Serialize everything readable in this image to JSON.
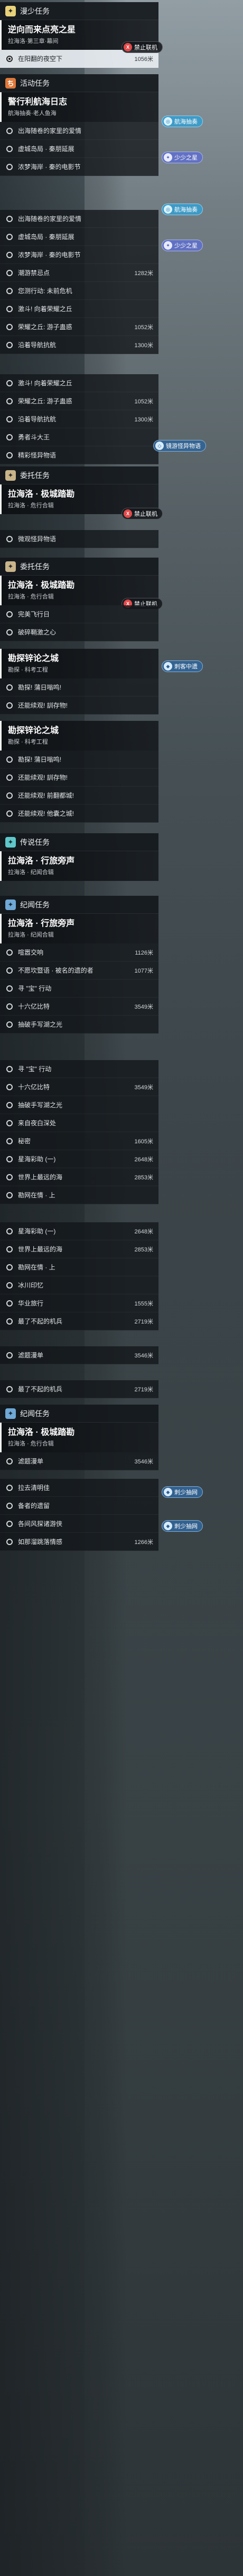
{
  "sections": {
    "main": {
      "icon": "✦",
      "title": "漫少任务"
    },
    "event": {
      "icon": "ち",
      "title": "活动任务"
    },
    "commission1": {
      "icon": "✦",
      "title": "委托任务"
    },
    "commission2": {
      "icon": "✦",
      "title": "委托任务"
    },
    "legend": {
      "icon": "✦",
      "title": "传说任务"
    },
    "world1": {
      "icon": "✦",
      "title": "纪闻任务"
    },
    "world2": {
      "icon": "✦",
      "title": "纪闻任务"
    }
  },
  "cards": {
    "c1": {
      "title": "逆向而来点亮之星",
      "sub": "拉海洛·第三章·幕间"
    },
    "c2": {
      "title": "警行利航海日志",
      "sub": "航海抽奏·老人鱼海"
    },
    "c3": {
      "title": "拉海洛 · 极城踏勘",
      "sub": "拉海洛 · 危行合辑"
    },
    "c4": {
      "title": "拉海洛 · 极城踏勘",
      "sub": "拉海洛 · 危行合辑"
    },
    "c5": {
      "title": "勘探锌论之城",
      "sub": "勘探 · 科考工程"
    },
    "c6": {
      "title": "勘探锌论之城",
      "sub": "勘探 · 科考工程"
    },
    "c7": {
      "title": "拉海洛 · 行旅旁声",
      "sub": "拉海洛 · 纪闻合辑"
    },
    "c8": {
      "title": "拉海洛 · 行旅旁声",
      "sub": "拉海洛 · 纪闻合辑"
    },
    "c9": {
      "title": "拉海洛 · 极城踏勘",
      "sub": "拉海洛 · 危行合辑"
    }
  },
  "rows": [
    {
      "label": "在阳翻的夜空下",
      "dist": "1056米",
      "active": true
    },
    {
      "label": "出海随卷的家里的爱情",
      "dist": ""
    },
    {
      "label": "虚城岛局 · 秦朋延展",
      "dist": ""
    },
    {
      "label": "浓梦海岸 · 秦的电影节",
      "dist": ""
    },
    {
      "label": "出海随卷的家里的爱情",
      "dist": ""
    },
    {
      "label": "虚城岛局 · 秦朋延展",
      "dist": ""
    },
    {
      "label": "浓梦海岸 · 秦的电影节",
      "dist": ""
    },
    {
      "label": "潮游禁忌点",
      "dist": "1282米"
    },
    {
      "label": "您测行动: 未前危机",
      "dist": ""
    },
    {
      "label": "激斗! 向着荣耀之丘",
      "dist": ""
    },
    {
      "label": "荣耀之丘: 游子蛊惑",
      "dist": "1052米"
    },
    {
      "label": "沿着导航抗航",
      "dist": "1300米"
    },
    {
      "label": "激斗! 向着荣耀之丘",
      "dist": ""
    },
    {
      "label": "荣耀之丘: 游子蛊惑",
      "dist": "1052米"
    },
    {
      "label": "沿着导航抗航",
      "dist": "1300米"
    },
    {
      "label": "勇者斗大王",
      "dist": ""
    },
    {
      "label": "精彩怪异物语",
      "dist": ""
    },
    {
      "label": "微观怪异物语",
      "dist": ""
    },
    {
      "label": "完美飞行日",
      "dist": ""
    },
    {
      "label": "破碎鞘激之心",
      "dist": ""
    },
    {
      "label": "勘探! 蒲日嗡鸣!",
      "dist": ""
    },
    {
      "label": "还能续观! 訓存物!",
      "dist": ""
    },
    {
      "label": "勘探! 蒲日嗡鸣!",
      "dist": ""
    },
    {
      "label": "还能续观! 訓存物!",
      "dist": ""
    },
    {
      "label": "还能续观! 前翻都城!",
      "dist": ""
    },
    {
      "label": "还能续观! 他囊之城!",
      "dist": ""
    },
    {
      "label": "喧嚣交响",
      "dist": "1126米"
    },
    {
      "label": "不愿坎暨语 · 被名的遗的者",
      "dist": "1077米"
    },
    {
      "label": "寻 \"宝\" 行动",
      "dist": ""
    },
    {
      "label": "十六亿比特",
      "dist": "3549米"
    },
    {
      "label": "抽破手写湖之光",
      "dist": ""
    },
    {
      "label": "寻 \"宝\" 行动",
      "dist": ""
    },
    {
      "label": "十六亿比特",
      "dist": "3549米"
    },
    {
      "label": "抽破手写湖之光",
      "dist": ""
    },
    {
      "label": "来自夜白深处",
      "dist": ""
    },
    {
      "label": "秘密",
      "dist": "1605米"
    },
    {
      "label": "星海彩助 (一)",
      "dist": "2648米"
    },
    {
      "label": "世界上最远的海",
      "dist": "2853米"
    },
    {
      "label": "勘网在情 · 上",
      "dist": ""
    },
    {
      "label": "星海彩助 (一)",
      "dist": "2648米"
    },
    {
      "label": "世界上最远的海",
      "dist": "2853米"
    },
    {
      "label": "勘网在情 · 上",
      "dist": ""
    },
    {
      "label": "冰川印忆",
      "dist": ""
    },
    {
      "label": "华业旅行",
      "dist": "1555米"
    },
    {
      "label": "最了不起的机兵",
      "dist": "2719米"
    },
    {
      "label": "滤题漫单",
      "dist": "3546米"
    },
    {
      "label": "最了不起的机兵",
      "dist": "2719米"
    },
    {
      "label": "滤题漫单",
      "dist": "3546米"
    },
    {
      "label": "拉去清明佳",
      "dist": ""
    },
    {
      "label": "备者的遗留",
      "dist": ""
    },
    {
      "label": "各间风探诸游侠",
      "dist": ""
    },
    {
      "label": "如那溜跳落情感",
      "dist": "1266米"
    }
  ],
  "badges": {
    "offline": {
      "icon": "X",
      "text": "禁止联机"
    },
    "sea": {
      "icon": "◎",
      "text": "航海抽奏"
    },
    "star": {
      "icon": "✦",
      "text": "少少之星"
    },
    "lost": {
      "icon": "◇",
      "text": "镜游怪异物语"
    },
    "crisis": {
      "icon": "◆",
      "text": "刺客中遗"
    },
    "explore": {
      "icon": "◆",
      "text": "刺少抽网"
    }
  }
}
